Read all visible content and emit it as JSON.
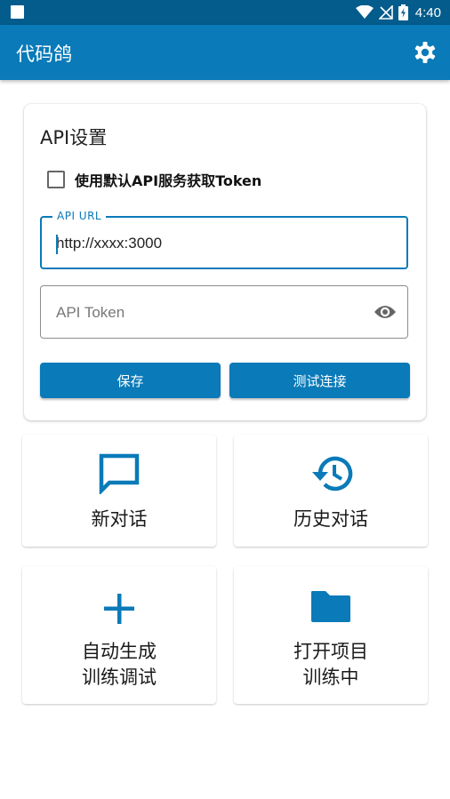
{
  "status_bar": {
    "time": "4:40"
  },
  "app_bar": {
    "title": "代码鸽"
  },
  "api_settings": {
    "title": "API设置",
    "use_default_label": "使用默认API服务获取Token",
    "use_default_checked": false,
    "url_field": {
      "label": "API URL",
      "value": "http://xxxx:3000"
    },
    "token_field": {
      "placeholder": "API Token",
      "value": ""
    },
    "save_label": "保存",
    "test_label": "测试连接"
  },
  "tiles": {
    "new_chat": "新对话",
    "history": "历史对话",
    "auto_train_line1": "自动生成",
    "auto_train_line2": "训练调试",
    "open_project_line1": "打开项目",
    "open_project_line2": "训练中"
  },
  "colors": {
    "primary": "#0a7ab8",
    "status_bar": "#035c8c"
  }
}
